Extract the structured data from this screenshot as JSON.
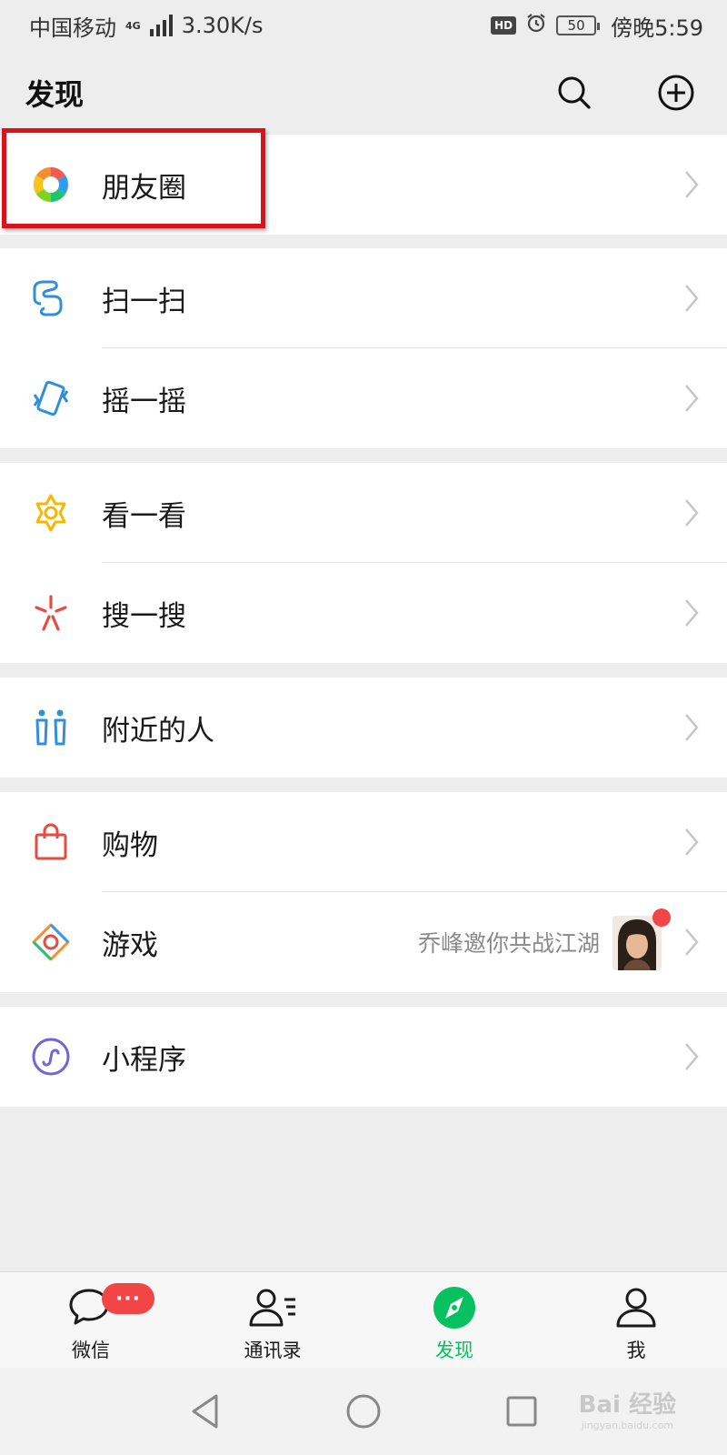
{
  "status_bar": {
    "carrier": "中国移动",
    "network": "4G",
    "speed": "3.30K/s",
    "hd": "HD",
    "battery": "50",
    "time": "傍晚5:59"
  },
  "header": {
    "title": "发现"
  },
  "sections": [
    {
      "items": [
        {
          "label": "朋友圈",
          "icon": "moments-icon"
        }
      ]
    },
    {
      "items": [
        {
          "label": "扫一扫",
          "icon": "scan-icon"
        },
        {
          "label": "摇一摇",
          "icon": "shake-icon"
        }
      ]
    },
    {
      "items": [
        {
          "label": "看一看",
          "icon": "top-stories-icon"
        },
        {
          "label": "搜一搜",
          "icon": "search-icon"
        }
      ]
    },
    {
      "items": [
        {
          "label": "附近的人",
          "icon": "nearby-people-icon"
        }
      ]
    },
    {
      "items": [
        {
          "label": "购物",
          "icon": "shopping-bag-icon"
        },
        {
          "label": "游戏",
          "icon": "games-icon",
          "extra": "乔峰邀你共战江湖"
        }
      ]
    },
    {
      "items": [
        {
          "label": "小程序",
          "icon": "mini-programs-icon"
        }
      ]
    }
  ],
  "tabbar": {
    "tabs": [
      {
        "label": "微信",
        "icon": "chat-icon",
        "badge": "···"
      },
      {
        "label": "通讯录",
        "icon": "contacts-icon"
      },
      {
        "label": "发现",
        "icon": "discover-icon",
        "active": true
      },
      {
        "label": "我",
        "icon": "me-icon"
      }
    ]
  },
  "watermark": {
    "brand": "Bai 经验",
    "url": "jingyan.baidu.com"
  },
  "colors": {
    "accent": "#07c160",
    "badge": "#f24646",
    "highlight": "#d8131b",
    "background": "#ededed"
  }
}
